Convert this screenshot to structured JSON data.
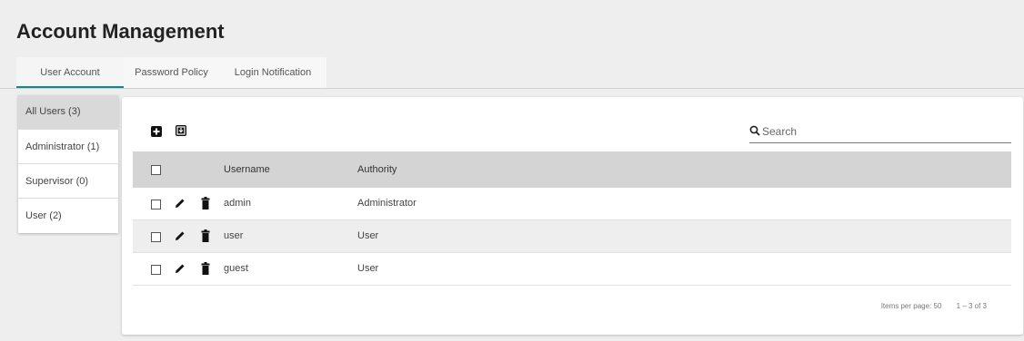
{
  "header": {
    "title": "Account Management"
  },
  "tabs": [
    {
      "label": "User Account",
      "active": true
    },
    {
      "label": "Password Policy",
      "active": false
    },
    {
      "label": "Login Notification",
      "active": false
    }
  ],
  "filters": [
    {
      "label": "All Users (3)",
      "selected": true
    },
    {
      "label": "Administrator (1)",
      "selected": false
    },
    {
      "label": "Supervisor (0)",
      "selected": false
    },
    {
      "label": "User (2)",
      "selected": false
    }
  ],
  "toolbar": {
    "add_icon": "add-box-icon",
    "import_icon": "import-box-icon"
  },
  "search": {
    "placeholder": "Search",
    "icon": "search-icon"
  },
  "table": {
    "columns": [
      "Username",
      "Authority"
    ],
    "rows": [
      {
        "username": "admin",
        "authority": "Administrator"
      },
      {
        "username": "user",
        "authority": "User"
      },
      {
        "username": "guest",
        "authority": "User"
      }
    ]
  },
  "pagination": {
    "items_per_page": "Items per page: 50",
    "range": "1 – 3 of 3"
  },
  "colors": {
    "accent": "#0a8a8a",
    "header_bg": "#d4d4d4",
    "page_bg": "#eeeeee"
  }
}
